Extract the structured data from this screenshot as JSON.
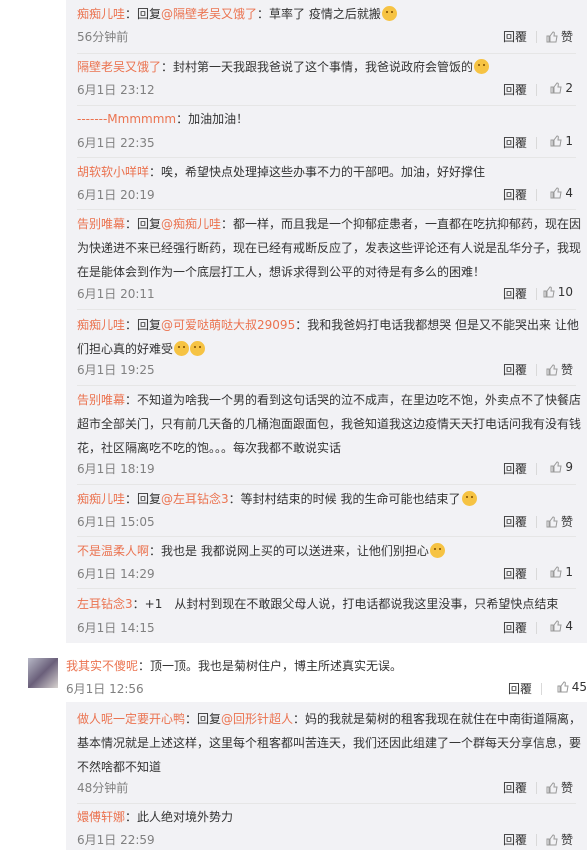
{
  "reply_label": "回复",
  "reply_btn_label": "回覆",
  "replies_top": [
    {
      "user": "痴痴儿哇",
      "body_pre": "：回复",
      "mention": "@隔壁老吴又饿了",
      "body": "：草率了 疫情之后就搬",
      "time": "56分钟前",
      "likes": "赞"
    },
    {
      "user": "隔壁老吴又饿了",
      "body_pre": "",
      "mention": "",
      "body": "：封村第一天我跟我爸说了这个事情，我爸说政府会管饭的",
      "time": "6月1日 23:12",
      "likes": "2"
    },
    {
      "user": "-------Mmmmmm",
      "body_pre": "",
      "mention": "",
      "body": "：加油加油！",
      "time": "6月1日 22:35",
      "likes": "1"
    },
    {
      "user": "胡软软小咩咩",
      "body_pre": "",
      "mention": "",
      "body": "：唉，希望快点处理掉这些办事不力的干部吧。加油，好好撑住",
      "time": "6月1日 20:19",
      "likes": "4"
    },
    {
      "user": "告别唯幕",
      "body_pre": "：回复",
      "mention": "@痴痴儿哇",
      "body": "：都一样，而且我是一个抑郁症患者，一直都在吃抗抑郁药，现在因为快递进不来已经强行断药，现在已经有戒断反应了，发表这些评论还有人说是乱华分子，我现在是能体会到作为一个底层打工人，想诉求得到公平的对待是有多么的困难！",
      "time": "6月1日 20:11",
      "likes": "10"
    },
    {
      "user": "痴痴儿哇",
      "body_pre": "：回复",
      "mention": "@可爱哒萌哒大叔29095",
      "body": "：我和我爸妈打电话我都想哭 但是又不能哭出来 让他们担心真的好难受",
      "time": "6月1日 19:25",
      "likes": "赞"
    },
    {
      "user": "告别唯幕",
      "body_pre": "",
      "mention": "",
      "body": "：不知道为啥我一个男的看到这句话哭的泣不成声，在里边吃不饱，外卖点不了快餐店超市全部关门，只有前几天备的几桶泡面跟面包，我爸知道我这边疫情天天打电话问我有没有钱花，社区隔离吃不吃的饱。。。每次我都不敢说实话",
      "time": "6月1日 18:19",
      "likes": "9"
    },
    {
      "user": "痴痴儿哇",
      "body_pre": "：回复",
      "mention": "@左耳钻念3",
      "body": "：等封村结束的时候 我的生命可能也结束了",
      "time": "6月1日 15:05",
      "likes": "赞"
    },
    {
      "user": "不是温柔人啊",
      "body_pre": "",
      "mention": "",
      "body": "：我也是 我都说网上买的可以送进来，让他们别担心",
      "time": "6月1日 14:29",
      "likes": "1"
    },
    {
      "user": "左耳钻念3",
      "body_pre": "",
      "mention": "",
      "body": "：+1　从封村到现在不敢跟父母人说，打电话都说我这里没事，只希望快点结束",
      "time": "6月1日 14:15",
      "likes": "4"
    }
  ],
  "main_comment": {
    "user": "我其实不傻呢",
    "body": "：顶一顶。我也是菊树住户，博主所述真实无误。",
    "time": "6月1日 12:56",
    "likes": "45"
  },
  "replies_bottom": [
    {
      "user": "做人呢一定要开心鸭",
      "body_pre": "：回复",
      "mention": "@回形针超人",
      "body": "：妈的我就是菊树的租客我现在就住在中南街道隔离，基本情况就是上述这样，这里每个租客都叫苦连天，我们还因此组建了一个群每天分享信息，要不然啥都不知道",
      "time": "48分钟前",
      "likes": "赞"
    },
    {
      "user": "嬛傅轩娜",
      "body_pre": "",
      "mention": "",
      "body": "：此人绝对境外势力",
      "time": "6月1日 22:59",
      "likes": "赞"
    }
  ]
}
